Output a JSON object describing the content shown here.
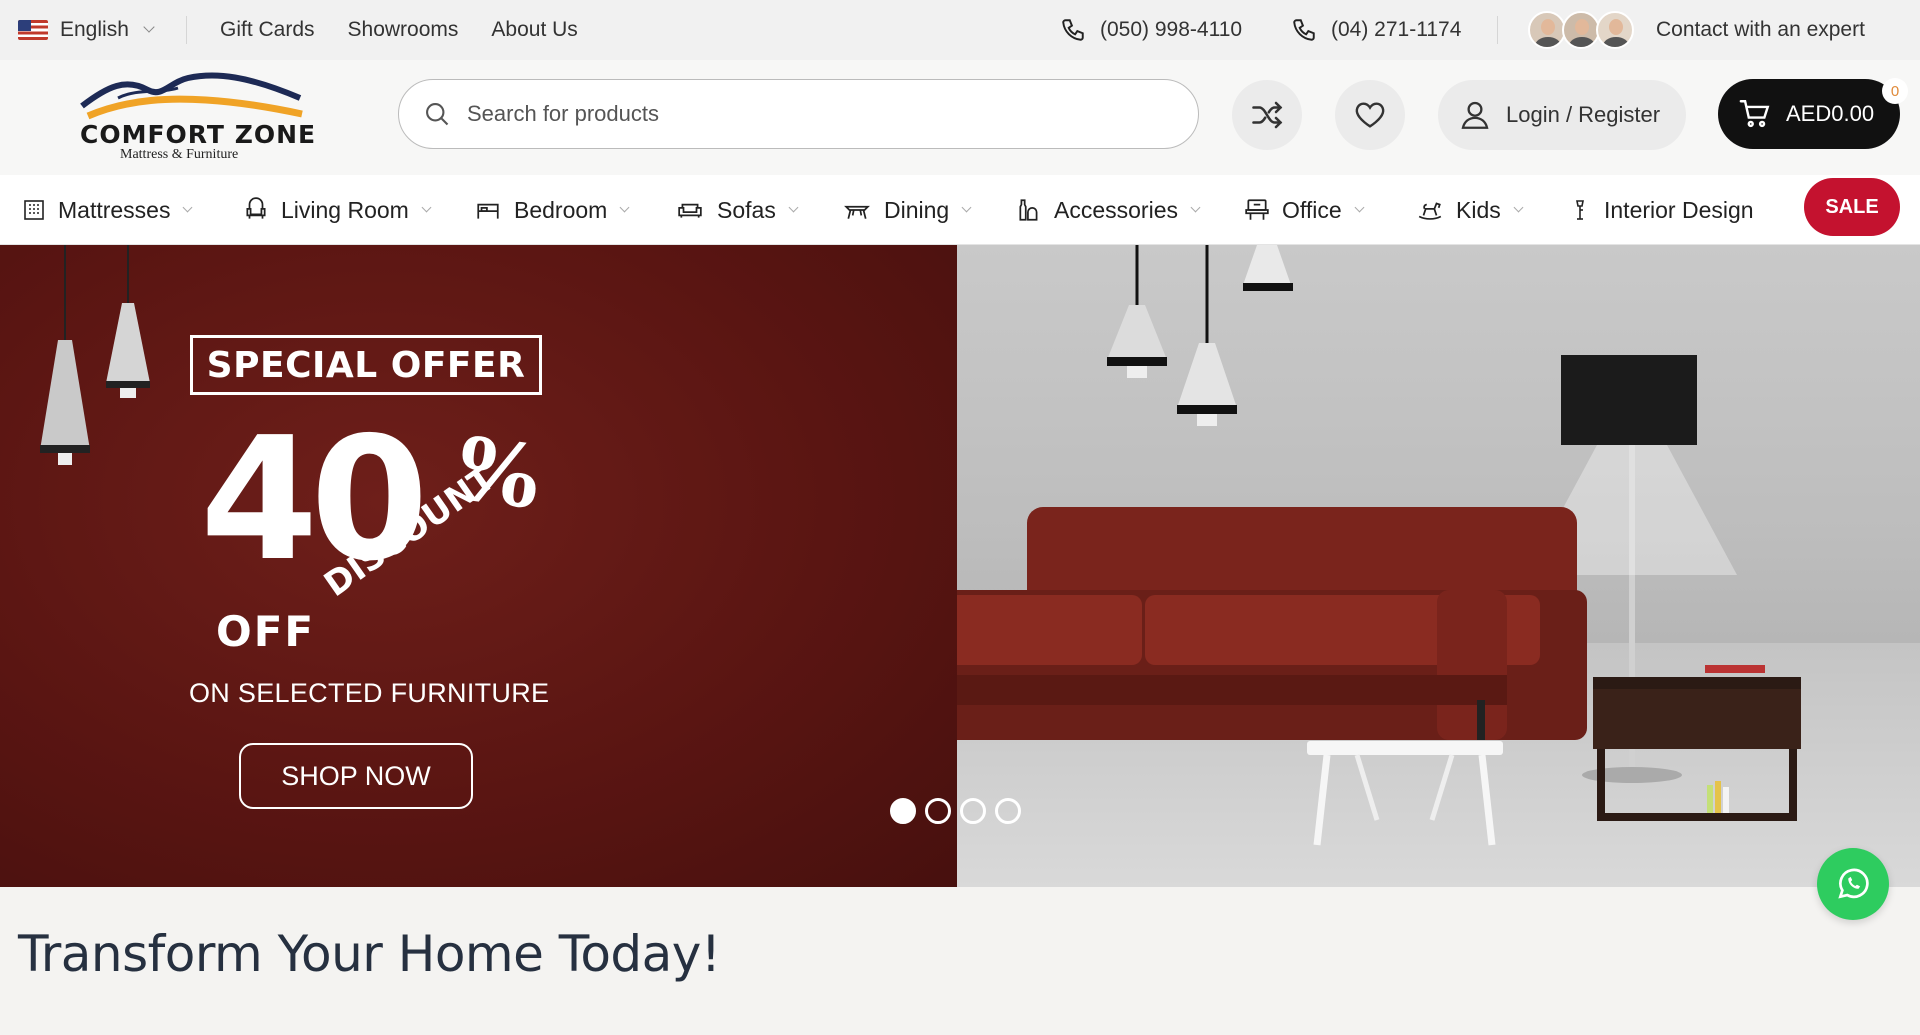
{
  "topbar": {
    "language": "English",
    "links": [
      "Gift Cards",
      "Showrooms",
      "About Us"
    ],
    "phone1": "(050) 998-4110",
    "phone2": "(04) 271-1174",
    "expert_label": "Contact with an expert"
  },
  "header": {
    "logo_name": "COMFORT ZONE",
    "logo_tagline": "Mattress & Furniture",
    "search_placeholder": "Search for products",
    "login_label": "Login / Register",
    "cart_total": "AED0.00",
    "cart_count": "0"
  },
  "nav": {
    "items": [
      {
        "label": "Mattresses",
        "icon": "building-icon"
      },
      {
        "label": "Living Room",
        "icon": "armchair-icon"
      },
      {
        "label": "Bedroom",
        "icon": "bed-icon"
      },
      {
        "label": "Sofas",
        "icon": "sofa-icon"
      },
      {
        "label": "Dining",
        "icon": "table-icon"
      },
      {
        "label": "Accessories",
        "icon": "vase-icon"
      },
      {
        "label": "Office",
        "icon": "desk-icon"
      },
      {
        "label": "Kids",
        "icon": "rocking-horse-icon"
      },
      {
        "label": "Interior Design",
        "icon": "lamp-icon"
      }
    ],
    "sale_label": "SALE"
  },
  "hero": {
    "badge": "SPECIAL OFFER",
    "percent": "40",
    "percent_sign": "%",
    "off": "OFF",
    "discount": "DISCOUNT",
    "subtitle": "ON SELECTED FURNITURE",
    "cta": "SHOP NOW",
    "slides_total": 4,
    "active_slide": 1
  },
  "section": {
    "title": "Transform Your Home Today!"
  },
  "colors": {
    "hero_red": "#5a1512",
    "sale_red": "#c4122f",
    "cart_black": "#111111",
    "whatsapp_green": "#2ecc5f"
  }
}
